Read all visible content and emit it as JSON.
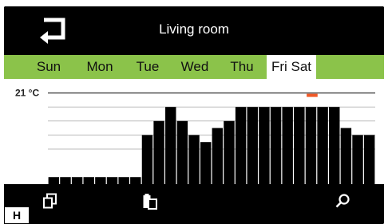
{
  "header": {
    "title": "Living room",
    "back_icon": "return-arrow-icon"
  },
  "days": [
    "Sun",
    "Mon",
    "Tue",
    "Wed",
    "Thu",
    "Fri",
    "Sat"
  ],
  "selected_day": "Fri",
  "chart_data": {
    "type": "bar",
    "reference_line_label": "21 °C",
    "reference_value": 21,
    "ylim": [
      14.5,
      22
    ],
    "gridlines": [
      20,
      19,
      18,
      17
    ],
    "values": [
      15,
      15,
      15,
      15,
      15,
      15,
      15,
      15,
      18,
      19,
      20,
      19,
      18,
      17.5,
      18.5,
      19,
      20,
      20,
      20,
      20,
      20,
      20,
      20,
      20,
      20,
      18.5,
      18,
      18
    ],
    "current_marker_index": 22,
    "marker_color": "#f05a28",
    "bar_color": "#000000"
  },
  "footer": {
    "copy_icon": "copy-icon",
    "paste_icon": "paste-icon",
    "search_icon": "magnifier-icon"
  },
  "badge": "H",
  "colors": {
    "accent": "#8bc34a",
    "background": "#000000"
  }
}
